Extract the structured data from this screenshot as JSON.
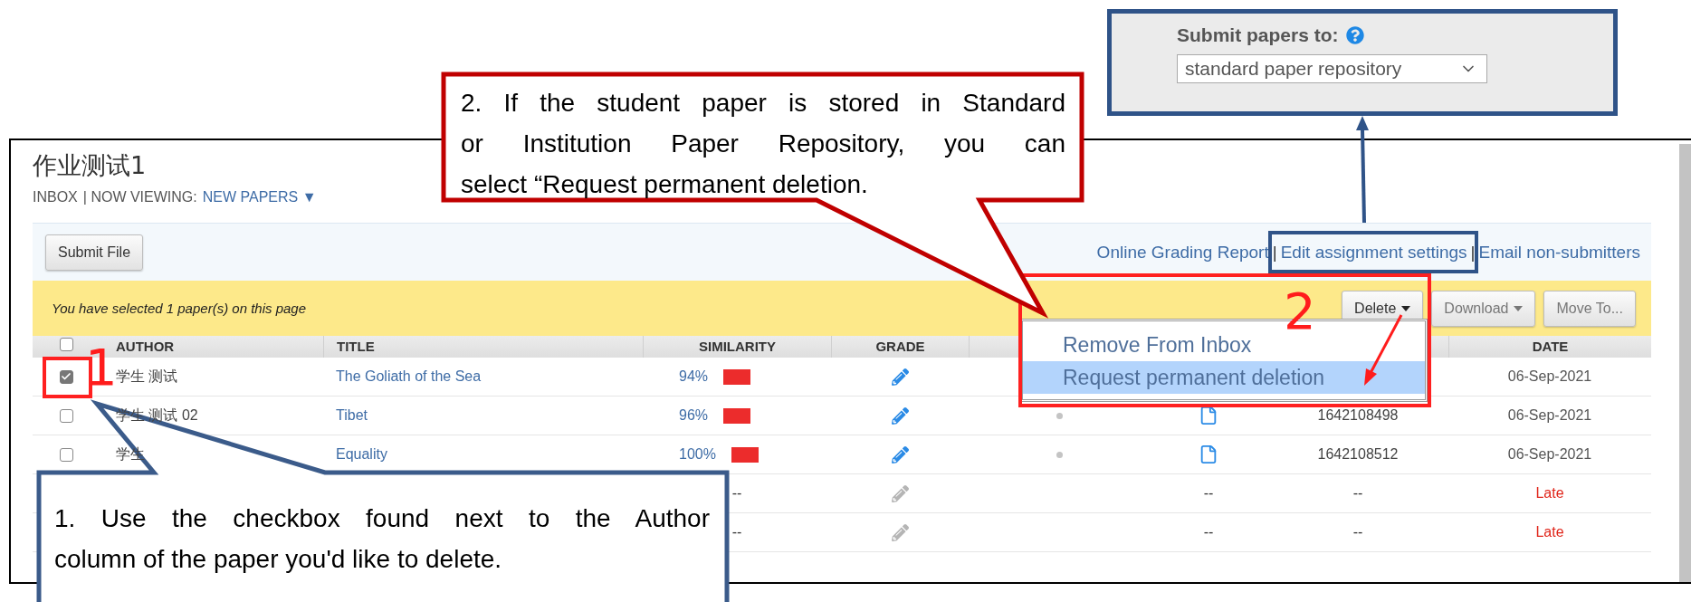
{
  "repository_setting": {
    "label": "Submit papers to:",
    "value": "standard paper repository"
  },
  "assignment": {
    "title": "作业测试1",
    "breadcrumb": "INBOX",
    "viewing_label": "| NOW VIEWING:",
    "view_menu": "NEW PAPERS",
    "view_caret": "▼"
  },
  "toolbar": {
    "submit_button": "Submit File",
    "links": [
      {
        "kind": "link",
        "label": "Online Grading Report"
      },
      {
        "kind": "separator",
        "label": "|"
      },
      {
        "kind": "link",
        "label": "Edit assignment settings"
      },
      {
        "kind": "separator",
        "label": "|"
      },
      {
        "kind": "link",
        "label": "Email non-submitters"
      }
    ]
  },
  "selection_bar": {
    "message": "You have selected 1 paper(s) on this page",
    "buttons": [
      {
        "label": "Delete",
        "caret": true,
        "disabled": false
      },
      {
        "label": "Download",
        "caret": true,
        "disabled": true
      },
      {
        "label": "Move To...",
        "caret": false,
        "disabled": true
      }
    ]
  },
  "table": {
    "select_all": {
      "checked": false
    },
    "columns": [
      "AUTHOR",
      "TITLE",
      "SIMILARITY",
      "GRADE",
      "DATE"
    ],
    "rows": [
      {
        "kind": "submitted",
        "checked": true,
        "author": "学生 测试",
        "title": "The Goliath of the Sea",
        "similarity": "94%",
        "date": "06-Sep-2021"
      },
      {
        "kind": "submitted",
        "checked": false,
        "author": "学生 测试 02",
        "title": "Tibet",
        "similarity": "96%",
        "paper_id": "1642108498",
        "date": "06-Sep-2021"
      },
      {
        "kind": "submitted",
        "checked": false,
        "author": "学生",
        "title": "Equality",
        "similarity": "100%",
        "paper_id": "1642108512",
        "date": "06-Sep-2021"
      },
      {
        "kind": "missing",
        "similarity": "--",
        "file": "--",
        "paper_id": "--",
        "date": "Late"
      },
      {
        "kind": "missing",
        "similarity": "--",
        "file": "--",
        "paper_id": "--",
        "date": "Late"
      }
    ]
  },
  "delete_menu": {
    "items": [
      {
        "label": "Remove From Inbox",
        "selected": false
      },
      {
        "label": "Request permanent deletion",
        "selected": true
      }
    ]
  },
  "annotations": {
    "step_markers": [
      "1",
      "2"
    ],
    "callouts": [
      {
        "kind": "red",
        "lines": [
          "2. If the student paper is stored in Standard",
          "or Institution Paper Repository, you can",
          "select “Request permanent deletion."
        ]
      },
      {
        "kind": "blue",
        "lines": [
          "1. Use the checkbox found next to the Author",
          "column of the paper you'd like to delete."
        ]
      }
    ]
  }
}
